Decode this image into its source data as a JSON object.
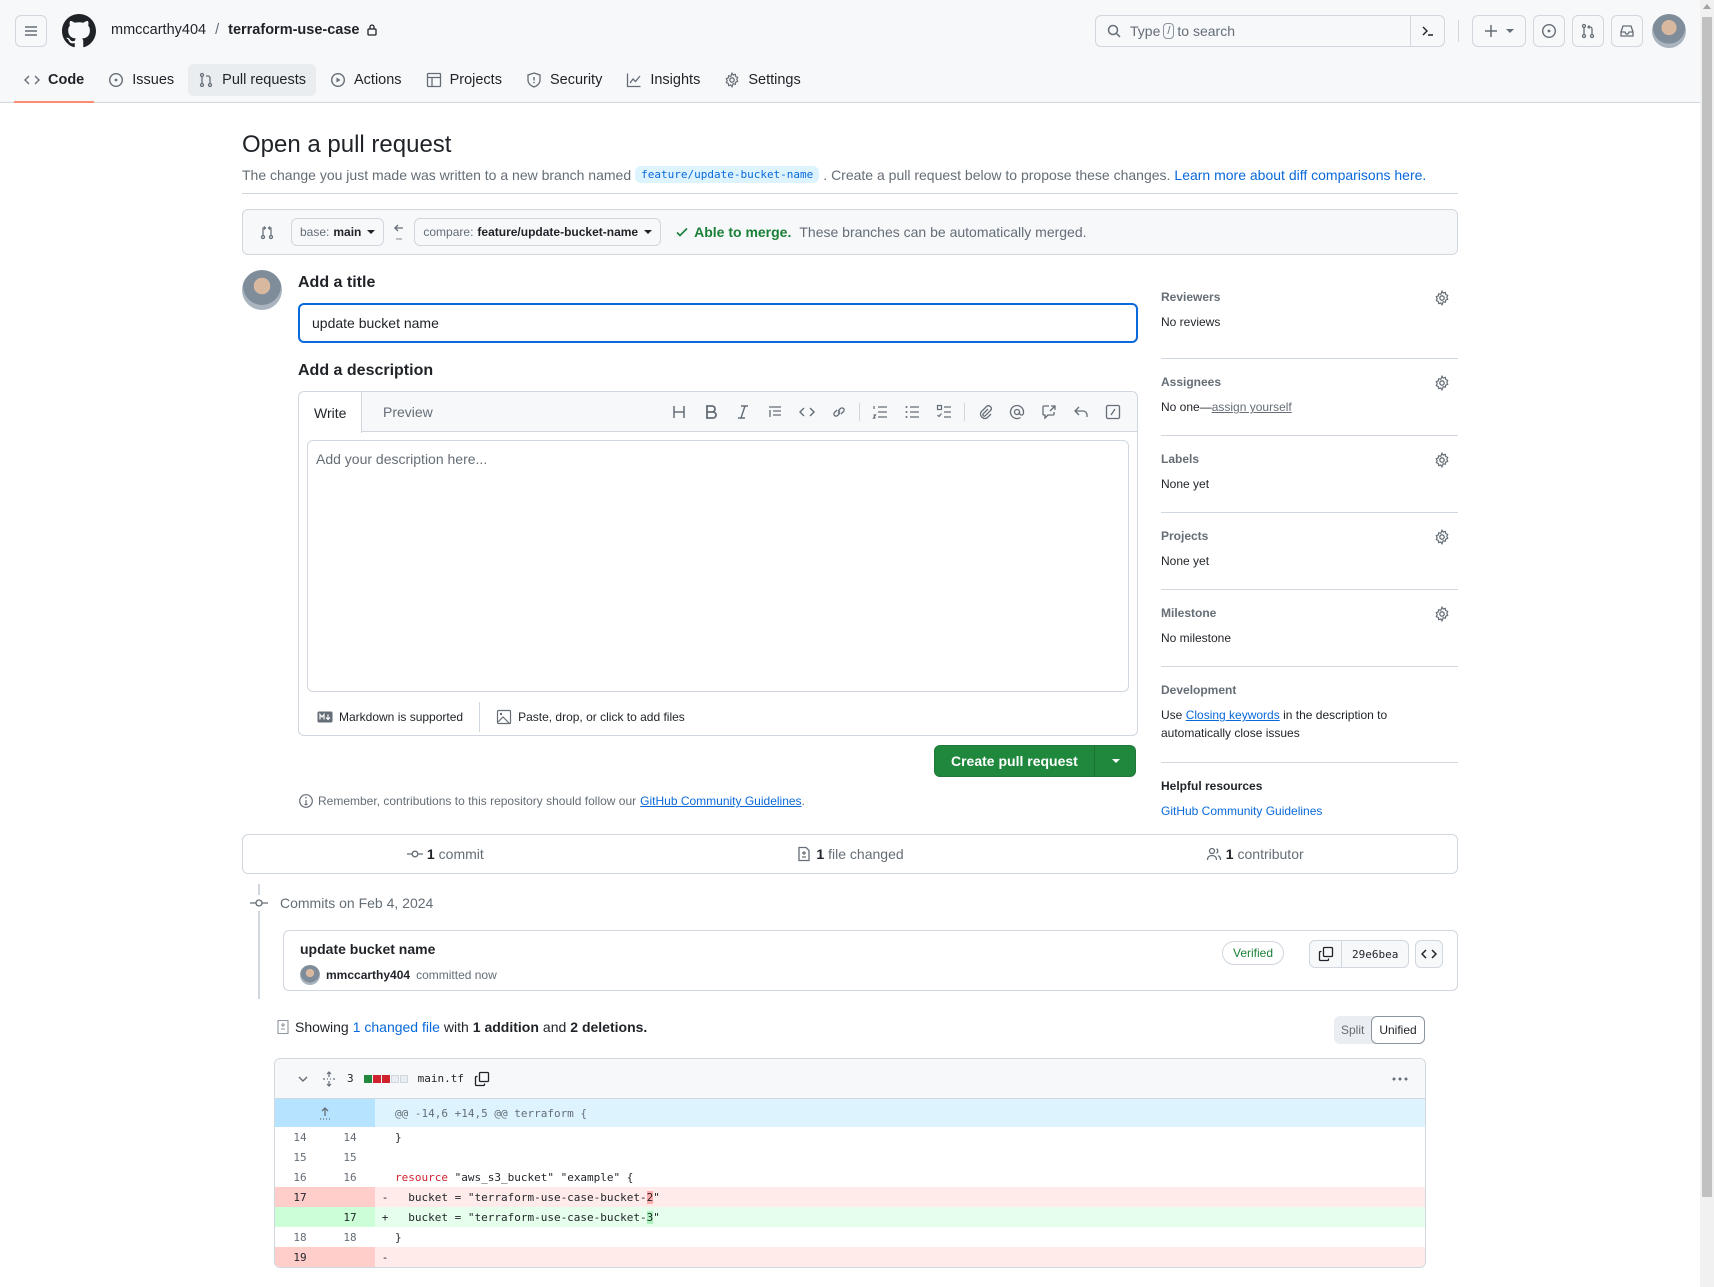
{
  "header": {
    "owner": "mmccarthy404",
    "separator": "/",
    "repo": "terraform-use-case",
    "search": {
      "prefix": "Type",
      "key": "/",
      "suffix": "to search"
    }
  },
  "nav_tabs": [
    {
      "label": "Code",
      "icon": "code-icon",
      "active": true
    },
    {
      "label": "Issues",
      "icon": "issue-icon"
    },
    {
      "label": "Pull requests",
      "icon": "pull-request-icon"
    },
    {
      "label": "Actions",
      "icon": "play-icon"
    },
    {
      "label": "Projects",
      "icon": "table-icon"
    },
    {
      "label": "Security",
      "icon": "shield-icon"
    },
    {
      "label": "Insights",
      "icon": "graph-icon"
    },
    {
      "label": "Settings",
      "icon": "gear-icon"
    }
  ],
  "page": {
    "title": "Open a pull request",
    "subtitle_before": "The change you just made was written to a new branch named",
    "branch_chip": "feature/update-bucket-name",
    "subtitle_after": ". Create a pull request below to propose these changes.",
    "learn_more": "Learn more about diff comparisons here."
  },
  "range": {
    "base_label": "base:",
    "base_value": "main",
    "compare_label": "compare:",
    "compare_value": "feature/update-bucket-name",
    "merge_status": "Able to merge.",
    "merge_message": "These branches can be automatically merged."
  },
  "form": {
    "title_label": "Add a title",
    "title_value": "update bucket name",
    "desc_label": "Add a description",
    "tab_write": "Write",
    "tab_preview": "Preview",
    "desc_placeholder": "Add your description here...",
    "markdown_note": "Markdown is supported",
    "attach_note": "Paste, drop, or click to add files",
    "create_button": "Create pull request",
    "remember_text": "Remember, contributions to this repository should follow our",
    "guidelines_link": "GitHub Community Guidelines",
    "remember_end": "."
  },
  "sidebar": {
    "reviewers": {
      "title": "Reviewers",
      "value": "No reviews"
    },
    "assignees": {
      "title": "Assignees",
      "value": "No one—",
      "link": "assign yourself"
    },
    "labels": {
      "title": "Labels",
      "value": "None yet"
    },
    "projects": {
      "title": "Projects",
      "value": "None yet"
    },
    "milestone": {
      "title": "Milestone",
      "value": "No milestone"
    },
    "development": {
      "title": "Development",
      "before": "Use",
      "link": "Closing keywords",
      "after": "in the description to automatically close issues"
    },
    "helpful": {
      "title": "Helpful resources",
      "link": "GitHub Community Guidelines"
    }
  },
  "summary": {
    "commits_count": "1",
    "commits_label": "commit",
    "files_count": "1",
    "files_label": "file changed",
    "contributors_count": "1",
    "contributors_label": "contributor"
  },
  "commits": {
    "header": "Commits on Feb 4, 2024",
    "items": [
      {
        "title": "update bucket name",
        "author": "mmccarthy404",
        "time": "committed now",
        "badge": "Verified",
        "sha": "29e6bea"
      }
    ]
  },
  "diff_summary": {
    "showing": "Showing",
    "changed_files": "1 changed file",
    "with": "with",
    "additions": "1 addition",
    "and": "and",
    "deletions": "2 deletions."
  },
  "view_toggle": {
    "split": "Split",
    "unified": "Unified",
    "selected": "Unified"
  },
  "diff": {
    "changes_count": "3",
    "filename": "main.tf",
    "diffstat": [
      "add",
      "del",
      "del",
      "neutral",
      "neutral"
    ],
    "hunk": "@@ -14,6 +14,5 @@ terraform {",
    "lines": [
      {
        "type": "ctx",
        "old": "14",
        "new": "14",
        "sign": "",
        "code": "}"
      },
      {
        "type": "ctx",
        "old": "15",
        "new": "15",
        "sign": "",
        "code": ""
      },
      {
        "type": "ctx",
        "old": "16",
        "new": "16",
        "sign": "",
        "keyword": "resource",
        "code": " \"aws_s3_bucket\" \"example\" {"
      },
      {
        "type": "del",
        "old": "17",
        "new": "",
        "sign": "-",
        "code": "  bucket = \"terraform-use-case-bucket-",
        "hl": "2",
        "tail": "\""
      },
      {
        "type": "add",
        "old": "",
        "new": "17",
        "sign": "+",
        "code": "  bucket = \"terraform-use-case-bucket-",
        "hl": "3",
        "tail": "\""
      },
      {
        "type": "ctx",
        "old": "18",
        "new": "18",
        "sign": "",
        "code": "}"
      },
      {
        "type": "del",
        "old": "19",
        "new": "",
        "sign": "-",
        "code": ""
      }
    ]
  }
}
